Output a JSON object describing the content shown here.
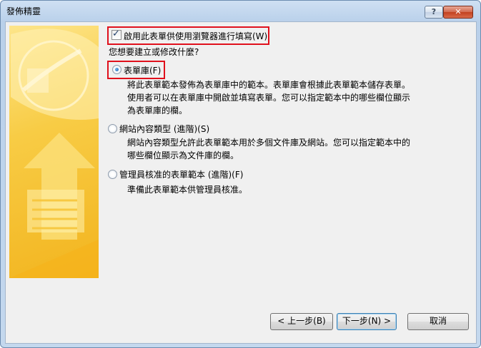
{
  "window": {
    "title": "發佈精靈"
  },
  "titlebar": {
    "help_label": "?",
    "close_label": "✕"
  },
  "enable_browser": {
    "label": "啟用此表單供使用瀏覽器進行填寫(W)",
    "checked": true
  },
  "question": "您想要建立或修改什麼?",
  "options": [
    {
      "label": "表單庫(F)",
      "selected": true,
      "description": "將此表單範本發佈為表單庫中的範本。表單庫會根據此表單範本儲存表單。使用者可以在表單庫中開啟並填寫表單。您可以指定範本中的哪些欄位顯示為表單庫的欄。"
    },
    {
      "label": "網站內容類型 (進階)(S)",
      "selected": false,
      "description": "網站內容類型允許此表單範本用於多個文件庫及網站。您可以指定範本中的哪些欄位顯示為文件庫的欄。"
    },
    {
      "label": "管理員核准的表單範本 (進階)(F)",
      "selected": false,
      "description": "準備此表單範本供管理員核准。"
    }
  ],
  "buttons": {
    "back": "< 上一步(B)",
    "next": "下一步(N) >",
    "cancel": "取消"
  }
}
